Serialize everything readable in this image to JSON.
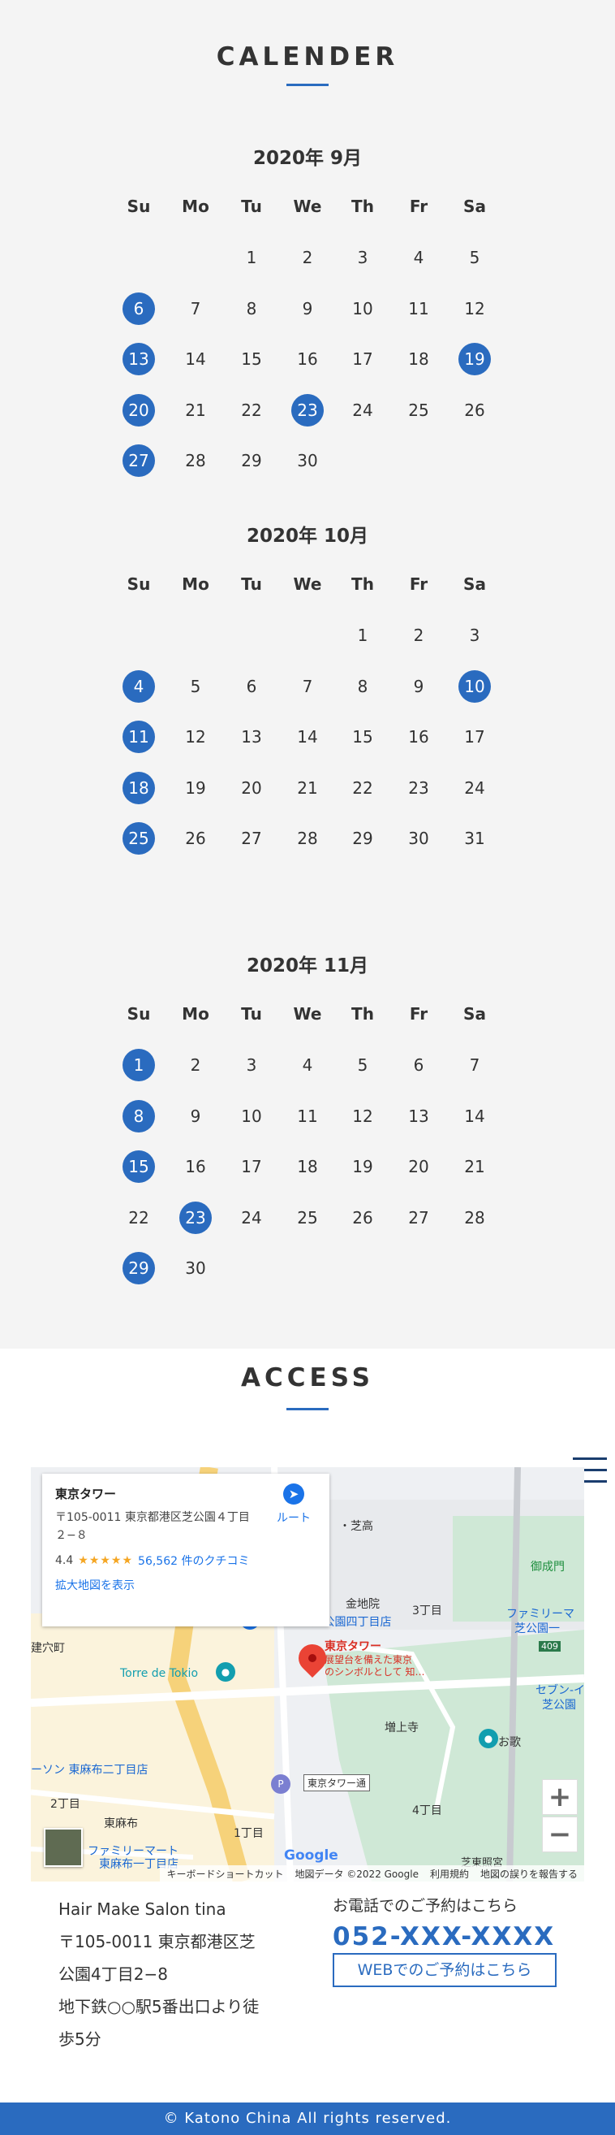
{
  "calendar": {
    "title": "CALENDER",
    "weekdays": [
      "Su",
      "Mo",
      "Tu",
      "We",
      "Th",
      "Fr",
      "Sa"
    ],
    "months": [
      {
        "title": "2020年 9月",
        "first_weekday": 2,
        "days_in_month": 30,
        "highlighted": [
          6,
          13,
          19,
          20,
          23,
          27
        ]
      },
      {
        "title": "2020年 10月",
        "first_weekday": 4,
        "days_in_month": 31,
        "highlighted": [
          4,
          10,
          11,
          18,
          25
        ]
      },
      {
        "title": "2020年 11月",
        "first_weekday": 0,
        "days_in_month": 30,
        "highlighted": [
          1,
          8,
          15,
          23,
          29
        ]
      }
    ]
  },
  "access": {
    "title": "ACCESS",
    "map": {
      "card": {
        "place": "東京タワー",
        "address": "〒105-0011 東京都港区芝公園４丁目２−８",
        "rating": "4.4",
        "stars": "★★★★★",
        "reviews": "56,562 件のクチコミ",
        "route": "ルート",
        "enlarge": "拡大地図を表示"
      },
      "labels": {
        "tower_name": "東京タワー",
        "tower_desc1": "展望台を備えた東京",
        "tower_desc2": "のシンボルとして 知…",
        "lawson": "ローソン 芝公園四丁目店",
        "torre": "Torre de Tokio",
        "konchiin": "金地院",
        "zojoji": "増上寺",
        "familymart_shiba": "ファミリーマ",
        "familymart_shiba2": "芝公園一",
        "seven": "セブン-イ",
        "seven2": "芝公園",
        "lawson_azabu": "ーソン 東麻布二丁目店",
        "familymart_azabu": "ファミリーマート",
        "familymart_azabu2": "東麻布一丁目店",
        "higashiazabu": "東麻布",
        "chome1": "1丁目",
        "chome2": "2丁目",
        "chome3": "3丁目",
        "chome4": "4丁目",
        "anamachi": "建穴町",
        "shiba_high": "・芝高",
        "onarimon": "御成門",
        "tower_street": "東京タワー通",
        "oka": "お歌",
        "route409": "409",
        "kagoya": "芝東照宮"
      },
      "zoom_in": "+",
      "zoom_out": "−",
      "footer": {
        "shortcuts": "キーボードショートカット",
        "data": "地図データ ©2022 Google",
        "terms": "利用規約",
        "report": "地図の誤りを報告する"
      },
      "google": "Google"
    },
    "salon_name": "Hair Make Salon tina",
    "address_line1": "〒105-0011 東京都港区芝",
    "address_line2": "公園4丁目2−8",
    "access_line1": "地下鉄○○駅5番出口より徒",
    "access_line2": "歩5分",
    "tel_label": "お電話でのご予約はこちら",
    "tel_number": "052-XXX-XXXX",
    "web_button": "WEBでのご予約はこちら"
  },
  "footer": {
    "copyright": "© Katono China All rights reserved."
  },
  "colors": {
    "accent": "#2a6bbf",
    "calendar_bg": "#f4f4f4",
    "text": "#333333"
  }
}
